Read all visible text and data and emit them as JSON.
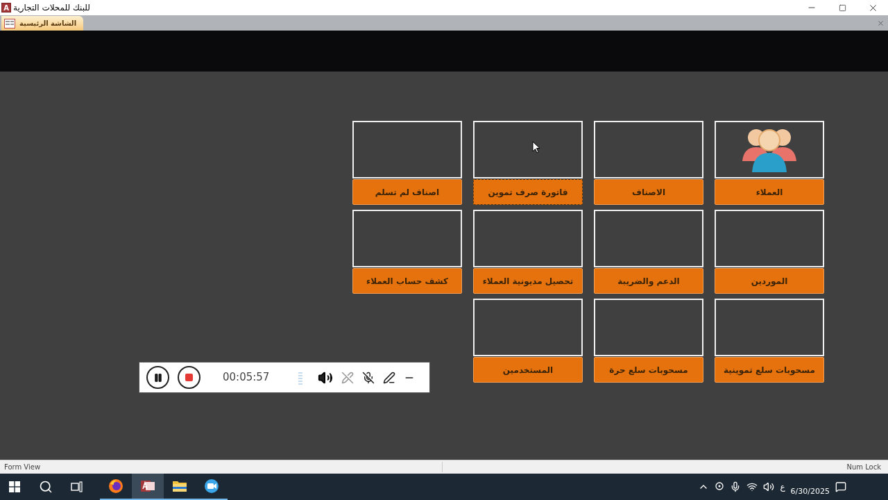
{
  "window": {
    "title": "للبنك للمحلات التجارية",
    "app_letter": "A"
  },
  "document_tab": {
    "label": "الشاشة الرئيسية"
  },
  "tiles": [
    {
      "label": "العملاء",
      "kind": "people",
      "focused": false
    },
    {
      "label": "الاصناف",
      "kind": "blank",
      "focused": false
    },
    {
      "label": "فاتورة صرف تموين",
      "kind": "blank",
      "focused": true
    },
    {
      "label": "اصناف لم تسلم",
      "kind": "blank",
      "focused": false
    },
    {
      "label": "الموردين",
      "kind": "blank",
      "focused": false
    },
    {
      "label": "الدعم والضريبة",
      "kind": "blank",
      "focused": false
    },
    {
      "label": "تحصيل مديونية العملاء",
      "kind": "blank",
      "focused": false
    },
    {
      "label": "كشف حساب العملاء",
      "kind": "blank",
      "focused": false
    },
    {
      "label": "مسحوبات سلع تموينية",
      "kind": "blank",
      "focused": false
    },
    {
      "label": "مسحوبات سلع حرة",
      "kind": "blank",
      "focused": false
    },
    {
      "label": "المستخدمين",
      "kind": "blank",
      "focused": false
    }
  ],
  "recorder": {
    "time": "00:05:57"
  },
  "status_bar": {
    "left": "Form View",
    "right": "Num Lock"
  },
  "taskbar": {
    "apps": [
      {
        "kind": "firefox",
        "selected": false
      },
      {
        "kind": "access",
        "selected": true
      },
      {
        "kind": "explorer",
        "selected": false
      },
      {
        "kind": "camera",
        "selected": false
      }
    ],
    "language": "ع",
    "date": "6/30/2025"
  }
}
